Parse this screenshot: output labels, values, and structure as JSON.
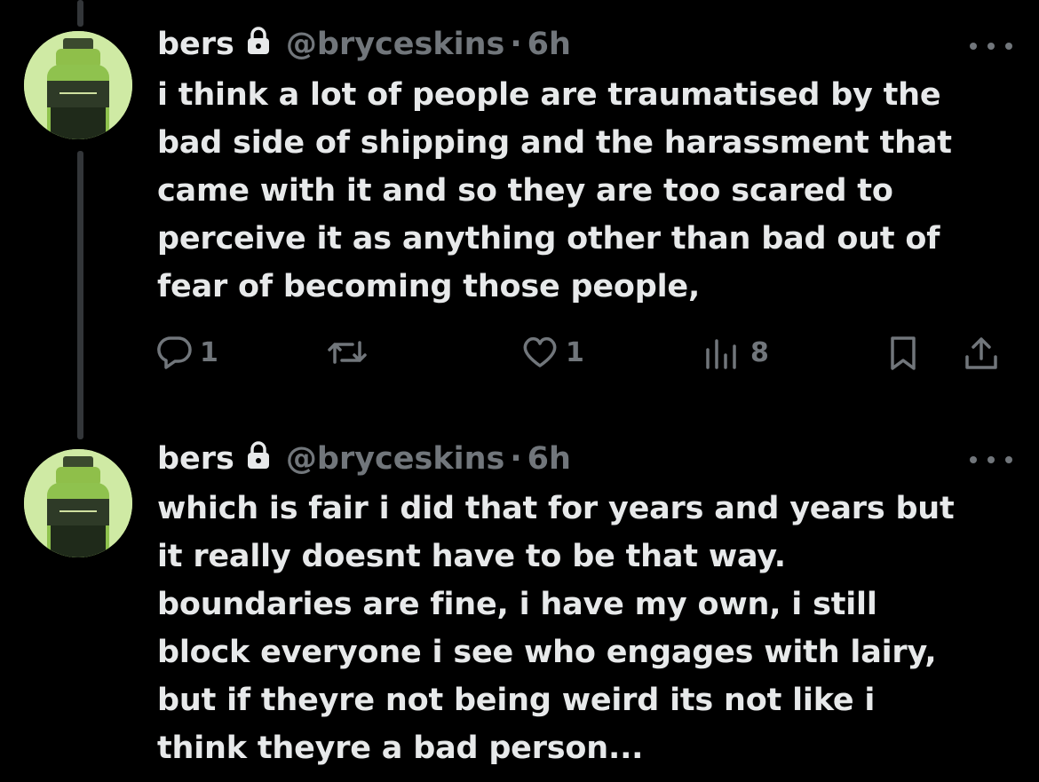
{
  "tweets": [
    {
      "author": {
        "name": "bers",
        "handle": "@bryceskins",
        "time": "6h",
        "avatar": "green-bottle-avatar",
        "locked": true
      },
      "text": "i think a lot of people are traumatised by the\nbad side of shipping and the harassment that\ncame with it and so they are too scared to\nperceive it as anything other than bad out of\nfear of becoming those people,",
      "stats": {
        "replies": "1",
        "reposts": "",
        "likes": "1",
        "views": "8"
      }
    },
    {
      "author": {
        "name": "bers",
        "handle": "@bryceskins",
        "time": "6h",
        "avatar": "green-bottle-avatar",
        "locked": true
      },
      "text": "which is fair i did that for years and years but\nit really doesnt have to be that way.\nboundaries are fine, i have my own, i still\nblock everyone i see who engages with lairy,\nbut if theyre not being weird its not like i\nthink theyre a bad person..."
    }
  ],
  "colors": {
    "background": "#000000",
    "text": "#e7e9ea",
    "muted": "#71767b",
    "avatar_bg": "#cfeaa4",
    "thread_line": "#333639"
  },
  "dot_separator": "·"
}
